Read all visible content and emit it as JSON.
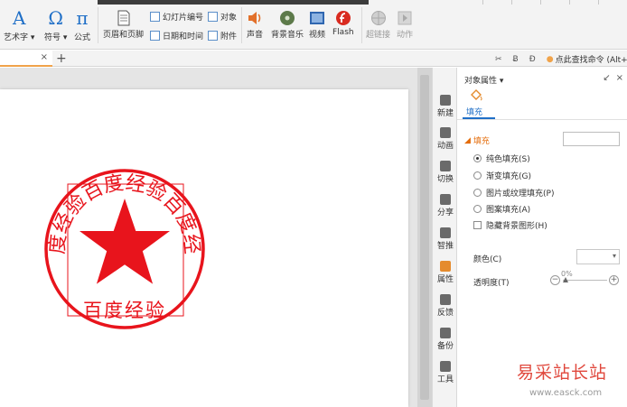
{
  "ribbon": {
    "art_text": "艺术字",
    "symbol": "符号",
    "formula": "公式",
    "header_footer": "页眉和页脚",
    "slide_number": "幻灯片编号",
    "object": "对象",
    "date_time": "日期和时间",
    "attachment": "附件",
    "sound": "声音",
    "bg_music": "背景音乐",
    "video": "视频",
    "flash": "Flash",
    "hyperlink": "超链接",
    "action": "动作"
  },
  "tabbar": {
    "close_glyph": "×",
    "add_glyph": "+",
    "find_command": "点此查找命令 (Alt+Q"
  },
  "slide": {
    "seal_arc_text": "百度经验百度经验百度经验",
    "seal_bottom_text": "百度经验",
    "seal_color": "#e8141c"
  },
  "sidestrip": {
    "items": [
      "新建",
      "动画",
      "切换",
      "分享",
      "智推",
      "属性",
      "反馈",
      "备份",
      "工具"
    ]
  },
  "props": {
    "title": "对象属性 ▾",
    "fill_tab": "填充",
    "fill_section": "填充",
    "options": [
      "纯色填充(S)",
      "渐变填充(G)",
      "图片或纹理填充(P)",
      "图案填充(A)"
    ],
    "hide_bg": "隐藏背景图形(H)",
    "color_label": "颜色(C)",
    "transparency_label": "透明度(T)",
    "transparency_value": "0%"
  },
  "watermark": {
    "cn": "易采站长站",
    "url": "www.easck.com"
  },
  "colors": {
    "accent_blue": "#1f6fc7",
    "accent_orange": "#e58b2d",
    "seal_red": "#e8141c"
  }
}
